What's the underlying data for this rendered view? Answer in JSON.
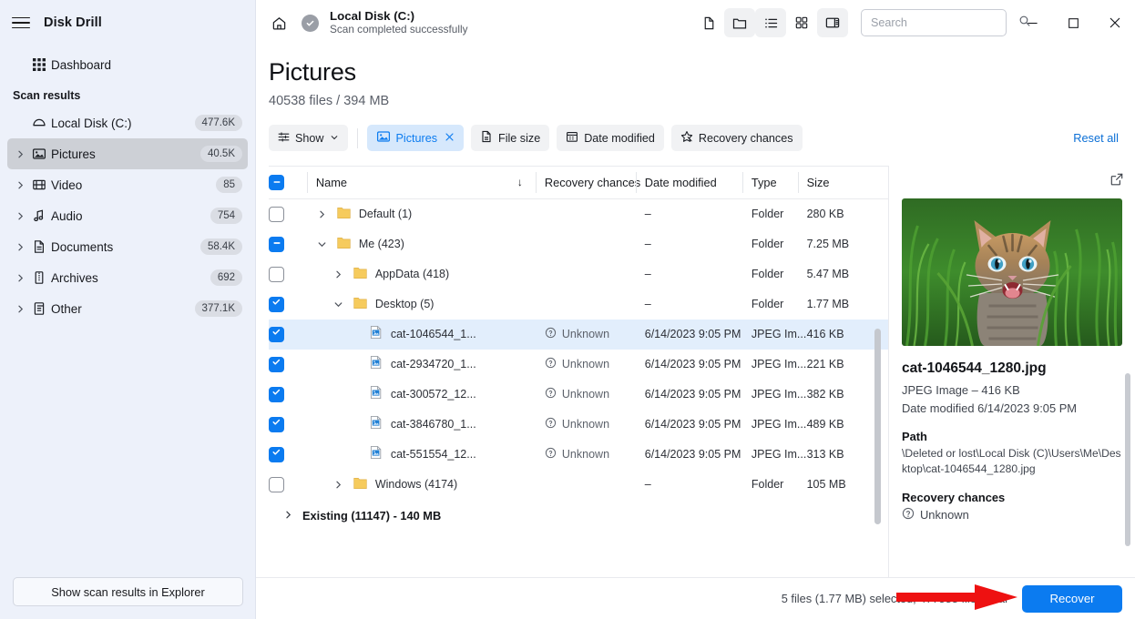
{
  "app": {
    "brand": "Disk Drill"
  },
  "sidebar": {
    "dashboard": {
      "label": "Dashboard",
      "icon": "grid-icon"
    },
    "section_label": "Scan results",
    "items": [
      {
        "label": "Local Disk (C:)",
        "count": "477.6K",
        "icon": "disk-icon",
        "expandable": false,
        "selected": false
      },
      {
        "label": "Pictures",
        "count": "40.5K",
        "icon": "image-icon",
        "expandable": true,
        "selected": true
      },
      {
        "label": "Video",
        "count": "85",
        "icon": "film-icon",
        "expandable": true,
        "selected": false
      },
      {
        "label": "Audio",
        "count": "754",
        "icon": "music-note-icon",
        "expandable": true,
        "selected": false
      },
      {
        "label": "Documents",
        "count": "58.4K",
        "icon": "document-icon",
        "expandable": true,
        "selected": false
      },
      {
        "label": "Archives",
        "count": "692",
        "icon": "archive-icon",
        "expandable": true,
        "selected": false
      },
      {
        "label": "Other",
        "count": "377.1K",
        "icon": "list-document-icon",
        "expandable": true,
        "selected": false
      }
    ],
    "explorer_button": "Show scan results in Explorer"
  },
  "titlebar": {
    "home_icon": "home-icon",
    "status_icon": "check-circle-icon",
    "title": "Local Disk (C:)",
    "subtitle": "Scan completed successfully",
    "icons": [
      "file-icon",
      "folder-icon",
      "list-view-icon",
      "grid-view-icon",
      "panel-toggle-icon"
    ],
    "window": {
      "minimize": "minimize-icon",
      "maximize": "maximize-icon",
      "close": "close-icon"
    }
  },
  "search": {
    "placeholder": "Search",
    "value": "",
    "icon": "search-icon"
  },
  "page": {
    "title": "Pictures",
    "subtitle": "40538 files / 394 MB"
  },
  "filters": {
    "show": {
      "label": "Show",
      "icon": "sliders-icon",
      "chevron": "chevron-down-icon"
    },
    "chips": [
      {
        "label": "Pictures",
        "icon": "image-icon",
        "active": true,
        "closable": true
      },
      {
        "label": "File size",
        "icon": "file-size-icon",
        "active": false,
        "closable": false
      },
      {
        "label": "Date modified",
        "icon": "calendar-icon",
        "active": false,
        "closable": false
      },
      {
        "label": "Recovery chances",
        "icon": "star-icon",
        "active": false,
        "closable": false
      }
    ],
    "reset": "Reset all"
  },
  "table": {
    "select_all_state": "indeterminate",
    "columns": [
      {
        "key": "name",
        "label": "Name",
        "sort": "down"
      },
      {
        "key": "recovery",
        "label": "Recovery chances"
      },
      {
        "key": "date",
        "label": "Date modified"
      },
      {
        "key": "type",
        "label": "Type"
      },
      {
        "key": "size",
        "label": "Size"
      }
    ],
    "rows": [
      {
        "check": "unchecked",
        "indent": 0,
        "chev": "right",
        "icon": "folder-icon",
        "name": "Default (1)",
        "recovery": "",
        "date": "–",
        "type": "Folder",
        "size": "280 KB",
        "selected": false
      },
      {
        "check": "indeterminate",
        "indent": 0,
        "chev": "down",
        "icon": "folder-icon",
        "name": "Me (423)",
        "recovery": "",
        "date": "–",
        "type": "Folder",
        "size": "7.25 MB",
        "selected": false
      },
      {
        "check": "unchecked",
        "indent": 1,
        "chev": "right",
        "icon": "folder-icon",
        "name": "AppData (418)",
        "recovery": "",
        "date": "–",
        "type": "Folder",
        "size": "5.47 MB",
        "selected": false
      },
      {
        "check": "checked",
        "indent": 1,
        "chev": "down",
        "icon": "folder-icon",
        "name": "Desktop (5)",
        "recovery": "",
        "date": "–",
        "type": "Folder",
        "size": "1.77 MB",
        "selected": false
      },
      {
        "check": "checked",
        "indent": 2,
        "chev": "none",
        "icon": "jpeg-file-icon",
        "name": "cat-1046544_1...",
        "recovery": "Unknown",
        "date": "6/14/2023 9:05 PM",
        "type": "JPEG Im...",
        "size": "416 KB",
        "selected": true
      },
      {
        "check": "checked",
        "indent": 2,
        "chev": "none",
        "icon": "jpeg-file-icon",
        "name": "cat-2934720_1...",
        "recovery": "Unknown",
        "date": "6/14/2023 9:05 PM",
        "type": "JPEG Im...",
        "size": "221 KB",
        "selected": false
      },
      {
        "check": "checked",
        "indent": 2,
        "chev": "none",
        "icon": "jpeg-file-icon",
        "name": "cat-300572_12...",
        "recovery": "Unknown",
        "date": "6/14/2023 9:05 PM",
        "type": "JPEG Im...",
        "size": "382 KB",
        "selected": false
      },
      {
        "check": "checked",
        "indent": 2,
        "chev": "none",
        "icon": "jpeg-file-icon",
        "name": "cat-3846780_1...",
        "recovery": "Unknown",
        "date": "6/14/2023 9:05 PM",
        "type": "JPEG Im...",
        "size": "489 KB",
        "selected": false
      },
      {
        "check": "checked",
        "indent": 2,
        "chev": "none",
        "icon": "jpeg-file-icon",
        "name": "cat-551554_12...",
        "recovery": "Unknown",
        "date": "6/14/2023 9:05 PM",
        "type": "JPEG Im...",
        "size": "313 KB",
        "selected": false
      },
      {
        "check": "unchecked",
        "indent": 1,
        "chev": "right",
        "icon": "folder-icon",
        "name": "Windows (4174)",
        "recovery": "",
        "date": "–",
        "type": "Folder",
        "size": "105 MB",
        "selected": false
      }
    ],
    "existing_group": {
      "label": "Existing (11147) - 140 MB",
      "chev": "right"
    }
  },
  "preview": {
    "expand_icon": "external-link-icon",
    "image_alt": "kitten-in-grass-photo",
    "filename": "cat-1046544_1280.jpg",
    "meta": "JPEG Image – 416 KB",
    "date_modified": "Date modified 6/14/2023 9:05 PM",
    "path_heading": "Path",
    "path_value": "\\Deleted or lost\\Local Disk (C)\\Users\\Me\\Desktop\\cat-1046544_1280.jpg",
    "recovery_heading": "Recovery chances",
    "recovery_value": "Unknown",
    "recovery_icon": "question-circle-icon"
  },
  "bottom": {
    "status": "5 files (1.77 MB) selected, 477588 files total",
    "recover_label": "Recover"
  },
  "annotation": {
    "type": "red-arrow",
    "color": "#ee1111",
    "points_to": "recover-button"
  },
  "colors": {
    "accent": "#0b7bf0",
    "sidebar_bg": "#edf1fa",
    "chip_active_bg": "#d6e8fc",
    "row_selected_bg": "#e2eefc",
    "annotation_red": "#ee1111"
  }
}
